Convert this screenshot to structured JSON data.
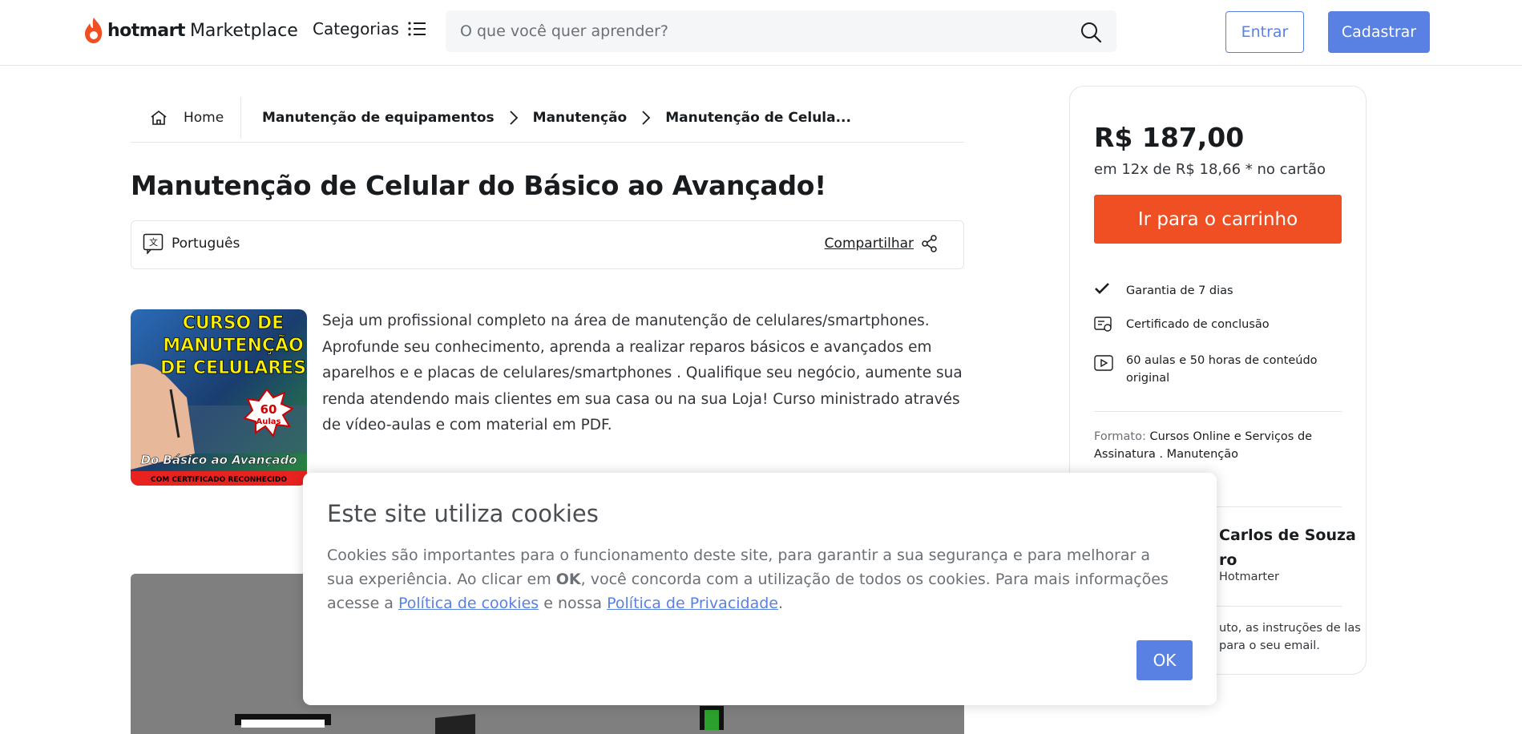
{
  "header": {
    "logo_bold": "hotmart",
    "logo_light": "Marketplace",
    "categories_label": "Categorias",
    "search_placeholder": "O que você quer aprender?",
    "login_label": "Entrar",
    "signup_label": "Cadastrar"
  },
  "breadcrumb": {
    "home": "Home",
    "items": [
      "Manutenção de equipamentos",
      "Manutenção",
      "Manutenção de Celula..."
    ]
  },
  "product": {
    "title": "Manutenção de Celular do Básico ao Avançado!",
    "language": "Português",
    "share_label": "Compartilhar",
    "thumbnail_lines": [
      "CURSO DE",
      "MANUTENÇÃO",
      "DE CELULARES",
      "60",
      "Aulas",
      "Do Básico ao Avançado",
      "COM CERTIFICADO RECONHECIDO"
    ],
    "description": "Seja um profissional completo na área de manutenção de celulares/smartphones. Aprofunde seu conhecimento, aprenda a realizar reparos básicos e avançados em aparelhos e e placas de celulares/smartphones . Qualifique seu negócio, aumente sua renda atendendo mais clientes em sua casa ou na sua Loja! Curso ministrado através de vídeo-aulas e com material em PDF."
  },
  "purchase_card": {
    "price": "R$ 187,00",
    "installments": "em 12x de R$ 18,66 * no cartão",
    "cart_button": "Ir para o carrinho",
    "features": [
      {
        "icon": "check-icon",
        "text": "Garantia de 7 dias"
      },
      {
        "icon": "certificate-icon",
        "text": "Certificado de conclusão"
      },
      {
        "icon": "play-icon",
        "text": "60 aulas e 50 horas de conteúdo original"
      }
    ],
    "format_label": "Formato:",
    "format_value": "Cursos Online e Serviços de Assinatura . Manutenção",
    "author_name": "Carlos de Souza ro",
    "author_role": "Hotmarter",
    "footer_note": "uto, as instruções de las para o seu email."
  },
  "cookie_banner": {
    "title": "Este site utiliza cookies",
    "text_1": "Cookies são importantes para o funcionamento deste site, para garantir a sua segurança e para melhorar a sua experiência. Ao clicar em ",
    "text_bold": "OK",
    "text_2": ", você concorda com a utilização de todos os cookies. Para mais informações acesse a ",
    "link_cookies": "Política de cookies",
    "text_3": " e nossa ",
    "link_privacy": "Política de Privacidade",
    "text_4": ".",
    "ok_label": "OK"
  },
  "colors": {
    "accent": "#5981e3",
    "cart": "#f04e23",
    "logo_flame": "#f04e23"
  }
}
